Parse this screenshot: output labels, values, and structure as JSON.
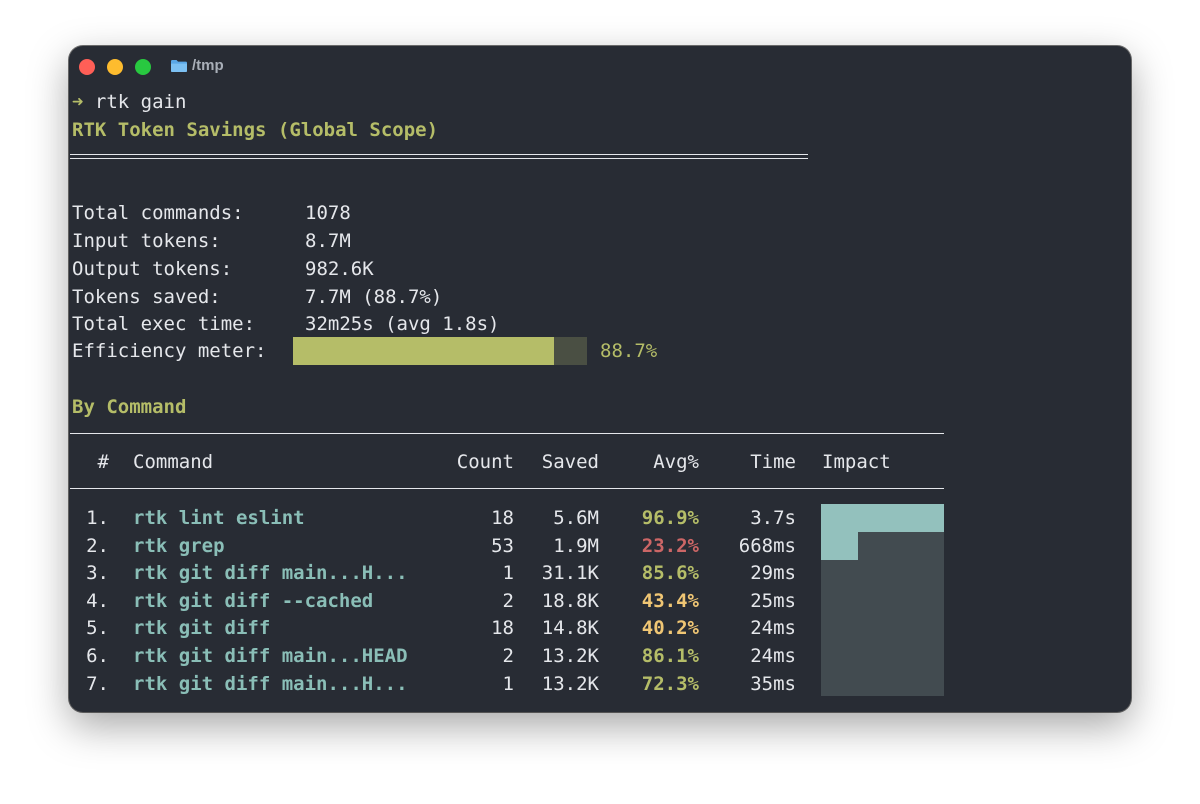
{
  "window": {
    "path": "/tmp"
  },
  "prompt": {
    "arrow": "➜",
    "command": "rtk gain"
  },
  "title": "RTK Token Savings (Global Scope)",
  "stats": [
    {
      "label": "Total commands:",
      "value": "1078"
    },
    {
      "label": "Input tokens:",
      "value": "8.7M"
    },
    {
      "label": "Output tokens:",
      "value": "982.6K"
    },
    {
      "label": "Tokens saved:",
      "value": "7.7M (88.7%)"
    },
    {
      "label": "Total exec time:",
      "value": "32m25s (avg 1.8s)"
    }
  ],
  "efficiency": {
    "label": "Efficiency meter:",
    "value_text": "88.7%",
    "fraction": 0.887
  },
  "by_command": {
    "heading": "By Command",
    "columns": {
      "num": "#",
      "command": "Command",
      "count": "Count",
      "saved": "Saved",
      "avg": "Avg%",
      "time": "Time",
      "impact": "Impact"
    },
    "rows": [
      {
        "num": "1.",
        "command": "rtk lint eslint",
        "count": "18",
        "saved": "5.6M",
        "avg": "96.9%",
        "avg_color": "#b5bd68",
        "time": "3.7s",
        "impact": 1.0
      },
      {
        "num": "2.",
        "command": "rtk grep",
        "count": "53",
        "saved": "1.9M",
        "avg": "23.2%",
        "avg_color": "#cc6666",
        "time": "668ms",
        "impact": 0.3
      },
      {
        "num": "3.",
        "command": "rtk git diff main...H...",
        "count": "1",
        "saved": "31.1K",
        "avg": "85.6%",
        "avg_color": "#b5bd68",
        "time": "29ms",
        "impact": 0
      },
      {
        "num": "4.",
        "command": "rtk git diff --cached",
        "count": "2",
        "saved": "18.8K",
        "avg": "43.4%",
        "avg_color": "#f0c674",
        "time": "25ms",
        "impact": 0
      },
      {
        "num": "5.",
        "command": "rtk git diff",
        "count": "18",
        "saved": "14.8K",
        "avg": "40.2%",
        "avg_color": "#f0c674",
        "time": "24ms",
        "impact": 0
      },
      {
        "num": "6.",
        "command": "rtk git diff main...HEAD",
        "count": "2",
        "saved": "13.2K",
        "avg": "86.1%",
        "avg_color": "#b5bd68",
        "time": "24ms",
        "impact": 0
      },
      {
        "num": "7.",
        "command": "rtk git diff main...H...",
        "count": "1",
        "saved": "13.2K",
        "avg": "72.3%",
        "avg_color": "#b5bd68",
        "time": "35ms",
        "impact": 0
      }
    ]
  }
}
